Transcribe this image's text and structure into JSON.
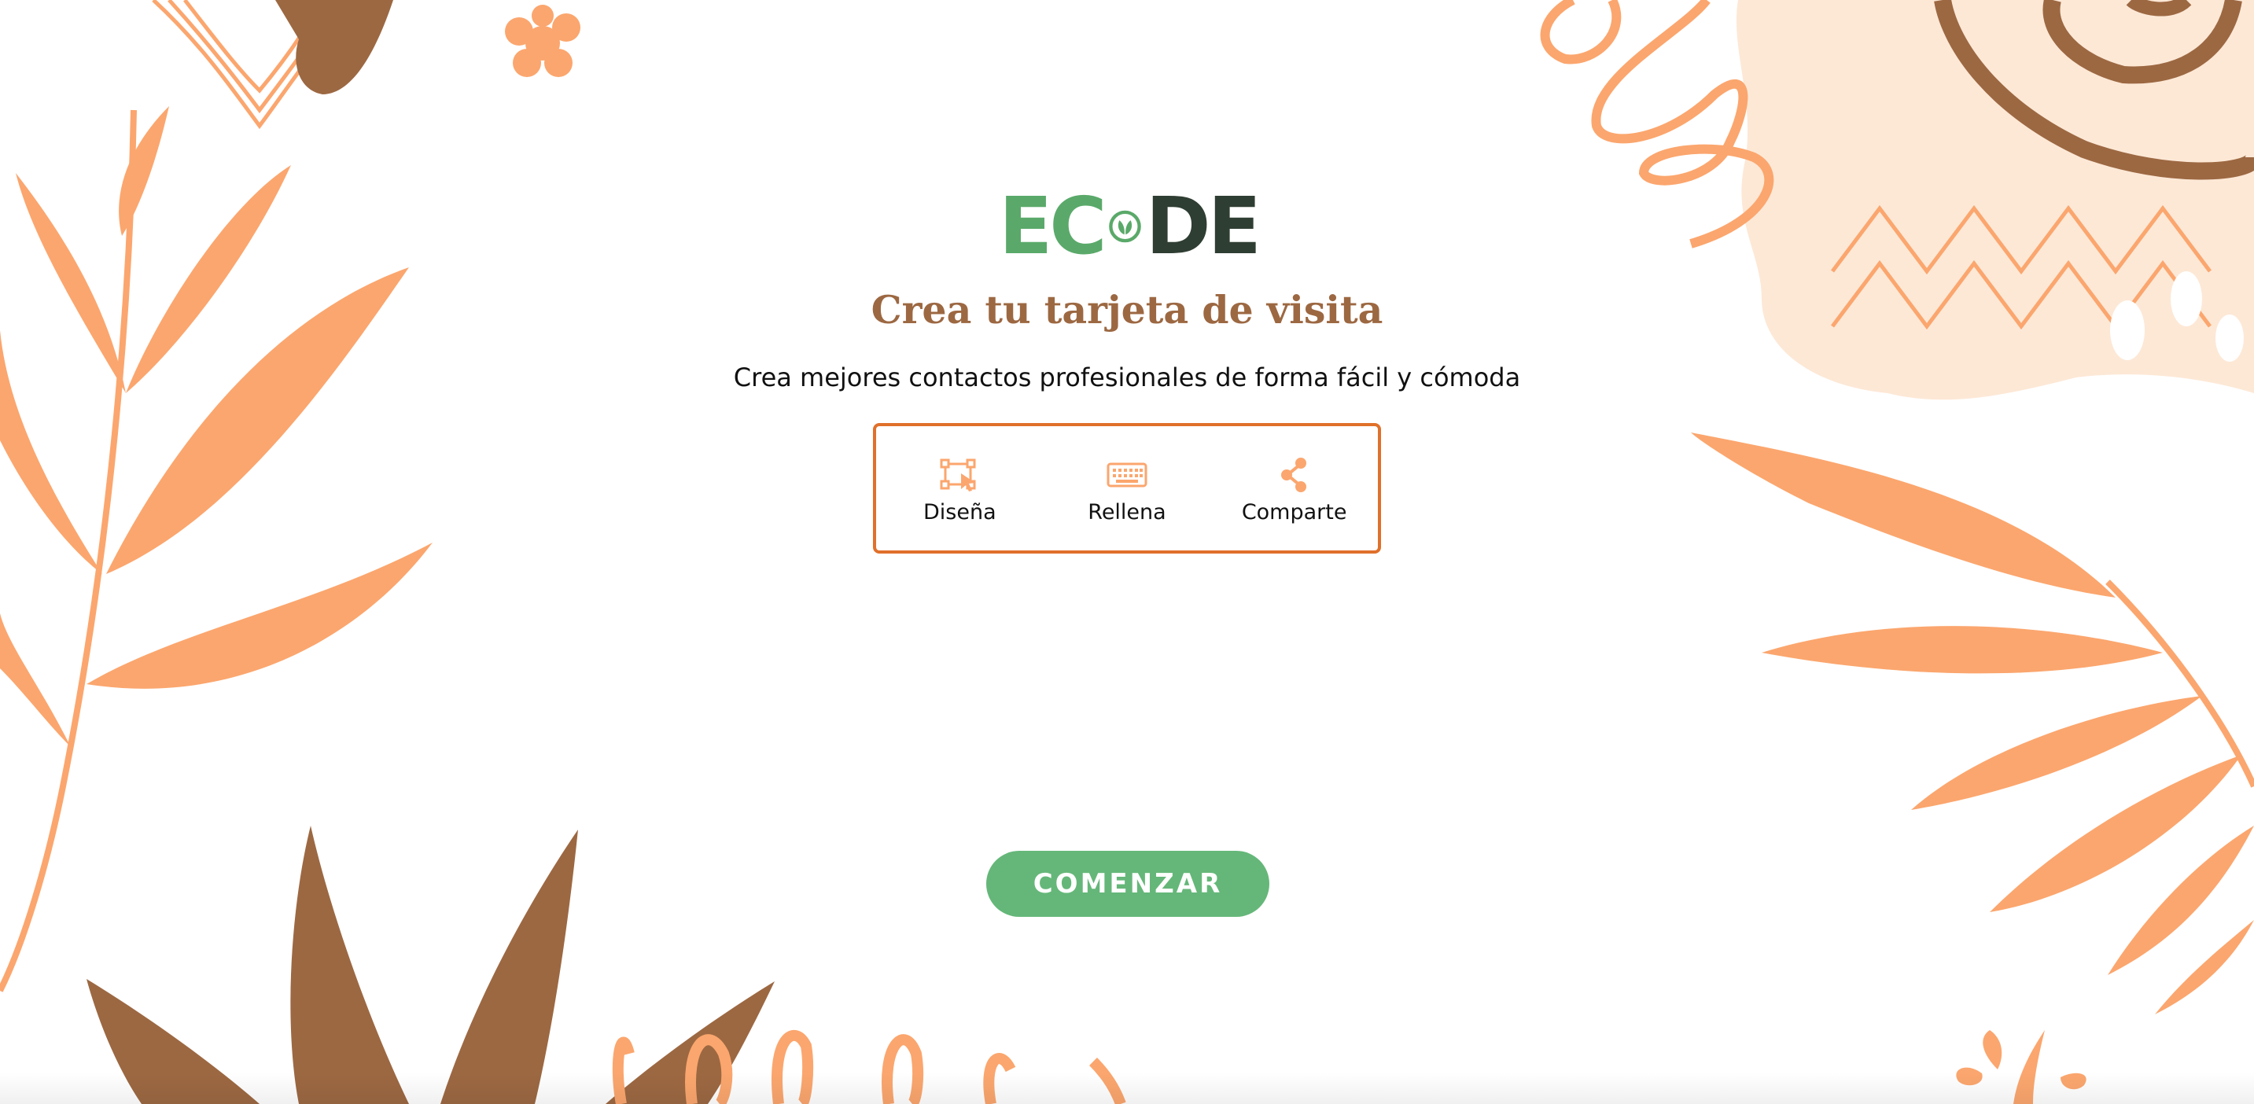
{
  "brand": {
    "logo_left": "EC",
    "logo_right": "DE",
    "logo_icon": "leaf-circle-icon",
    "colors": {
      "green": "#5aa96a",
      "dark": "#2f3e33"
    }
  },
  "hero": {
    "title": "Crea tu tarjeta de visita",
    "subtitle": "Crea mejores contactos profesionales de forma fácil y cómoda"
  },
  "steps": [
    {
      "label": "Diseña",
      "icon": "design-frame-icon"
    },
    {
      "label": "Rellena",
      "icon": "keyboard-icon"
    },
    {
      "label": "Comparte",
      "icon": "share-icon"
    }
  ],
  "cta": {
    "label": "COMENZAR",
    "color": "#65b779"
  },
  "theme": {
    "accent_orange": "#fba66e",
    "accent_brown": "#9c6842",
    "border_orange": "#e0702a",
    "peach": "#fde8d6"
  }
}
